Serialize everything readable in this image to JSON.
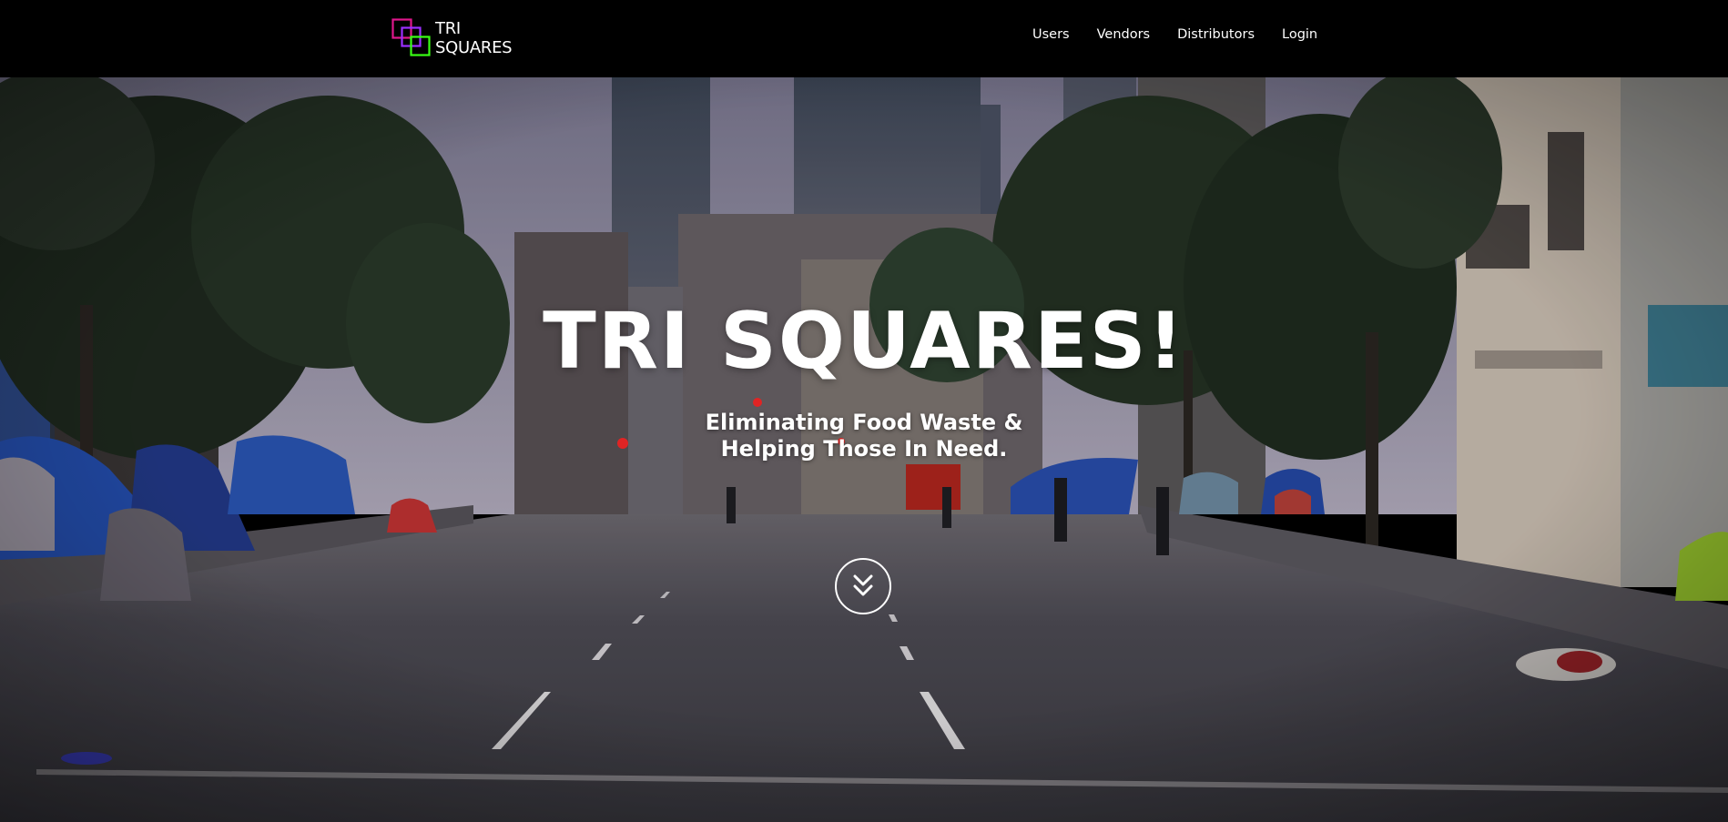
{
  "navbar": {
    "logo": {
      "line1": "TRI",
      "line2": "SQUARES",
      "colors": [
        "#e0178c",
        "#9b30ff",
        "#39ff14"
      ]
    },
    "links": [
      "Users",
      "Vendors",
      "Distributors",
      "Login"
    ]
  },
  "hero": {
    "title": "TRI SQUARES!",
    "subtitle_line1": "Eliminating Food Waste &",
    "subtitle_line2": "Helping Those In Need.",
    "scroll_icon": "double-chevron-down-icon"
  },
  "colors": {
    "navbar_bg": "#000000",
    "text": "#ffffff"
  }
}
